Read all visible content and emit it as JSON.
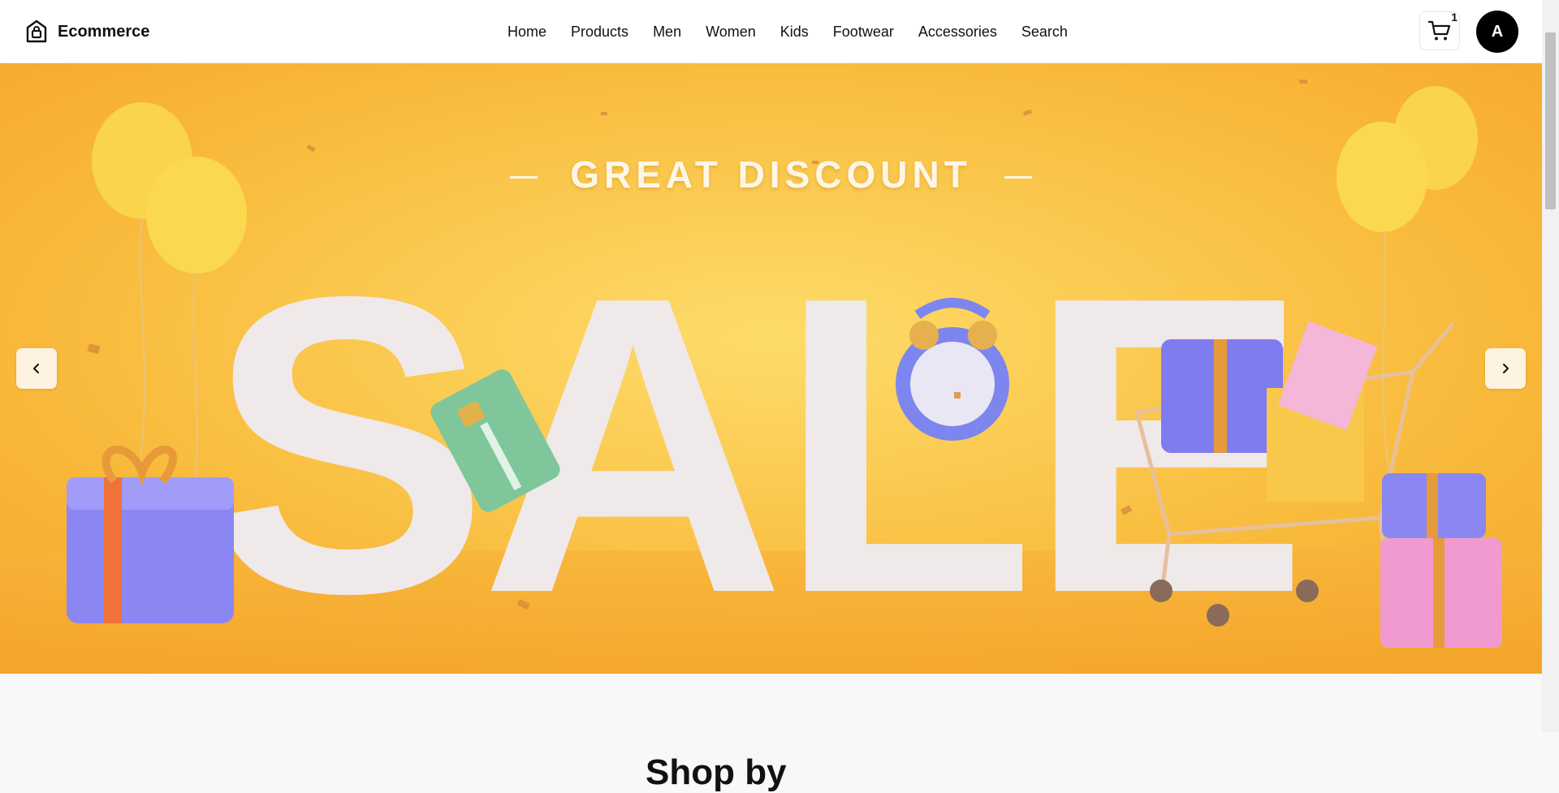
{
  "header": {
    "brand": "Ecommerce",
    "nav": [
      "Home",
      "Products",
      "Men",
      "Women",
      "Kids",
      "Footwear",
      "Accessories",
      "Search"
    ],
    "cart_count": "1",
    "avatar_initial": "A"
  },
  "hero": {
    "kicker": "GREAT DISCOUNT",
    "headline": "SALE"
  },
  "section": {
    "title": "Shop by"
  },
  "colors": {
    "hero_bg": "#f8b53a",
    "header_bg": "#ffffff",
    "avatar_bg": "#000000"
  }
}
